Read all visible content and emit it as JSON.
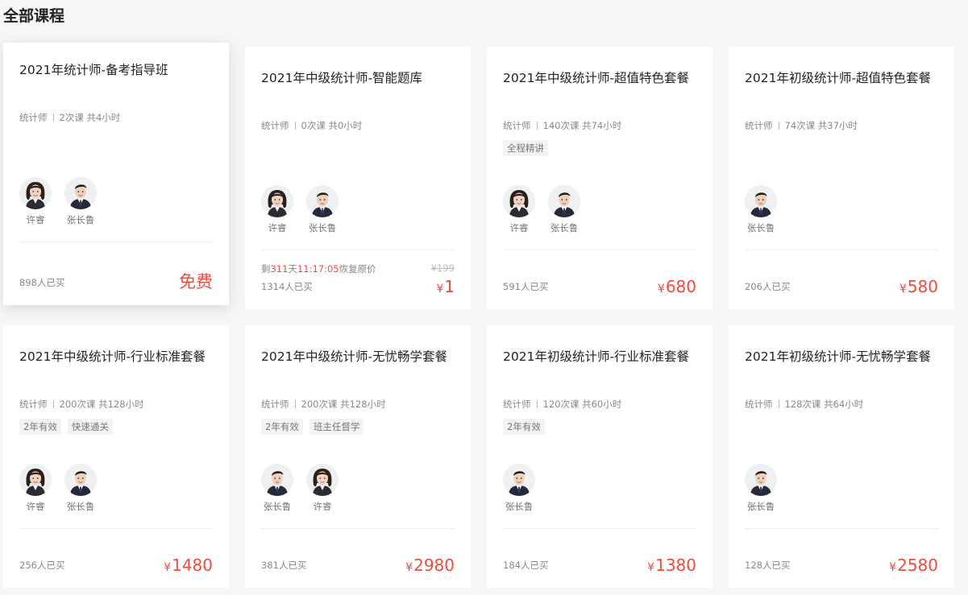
{
  "page": {
    "title": "全部课程"
  },
  "colors": {
    "accent": "#f24b3e",
    "background": "#f5f6f8"
  },
  "cards": [
    {
      "title": "2021年统计师-备考指导班",
      "category": "统计师",
      "lessons": "2次课 共4小时",
      "tags": [],
      "teachers": [
        {
          "name": "许睿",
          "icon": "female-teacher-avatar"
        },
        {
          "name": "张长鲁",
          "icon": "male-teacher-avatar"
        }
      ],
      "buyers": "898人已买",
      "price": "免费",
      "currency": ""
    },
    {
      "title": "2021年中级统计师-智能题库",
      "category": "统计师",
      "lessons": "0次课 共0小时",
      "tags": [],
      "teachers": [
        {
          "name": "许睿",
          "icon": "female-teacher-avatar"
        },
        {
          "name": "张长鲁",
          "icon": "male-teacher-avatar"
        }
      ],
      "buyers": "1314人已买",
      "price": "1",
      "currency": "¥",
      "countdown": {
        "prefix": "剩",
        "days": "311",
        "day_unit": "天",
        "time": "11:17:05",
        "suffix": "恢复原价"
      },
      "original_price": "¥199"
    },
    {
      "title": "2021年中级统计师-超值特色套餐",
      "category": "统计师",
      "lessons": "140次课 共74小时",
      "tags": [
        "全程精讲"
      ],
      "teachers": [
        {
          "name": "许睿",
          "icon": "female-teacher-avatar"
        },
        {
          "name": "张长鲁",
          "icon": "male-teacher-avatar"
        }
      ],
      "buyers": "591人已买",
      "price": "680",
      "currency": "¥"
    },
    {
      "title": "2021年初级统计师-超值特色套餐",
      "category": "统计师",
      "lessons": "74次课 共37小时",
      "tags": [],
      "teachers": [
        {
          "name": "张长鲁",
          "icon": "male-teacher-avatar"
        }
      ],
      "buyers": "206人已买",
      "price": "580",
      "currency": "¥"
    },
    {
      "title": "2021年中级统计师-行业标准套餐",
      "category": "统计师",
      "lessons": "200次课 共128小时",
      "tags": [
        "2年有效",
        "快速通关"
      ],
      "teachers": [
        {
          "name": "许睿",
          "icon": "female-teacher-avatar"
        },
        {
          "name": "张长鲁",
          "icon": "male-teacher-avatar"
        }
      ],
      "buyers": "256人已买",
      "price": "1480",
      "currency": "¥"
    },
    {
      "title": "2021年中级统计师-无忧畅学套餐",
      "category": "统计师",
      "lessons": "200次课 共128小时",
      "tags": [
        "2年有效",
        "班主任督学"
      ],
      "teachers": [
        {
          "name": "张长鲁",
          "icon": "male-teacher-avatar"
        },
        {
          "name": "许睿",
          "icon": "female-teacher-avatar"
        }
      ],
      "buyers": "381人已买",
      "price": "2980",
      "currency": "¥"
    },
    {
      "title": "2021年初级统计师-行业标准套餐",
      "category": "统计师",
      "lessons": "120次课 共60小时",
      "tags": [
        "2年有效"
      ],
      "teachers": [
        {
          "name": "张长鲁",
          "icon": "male-teacher-avatar"
        }
      ],
      "buyers": "184人已买",
      "price": "1380",
      "currency": "¥"
    },
    {
      "title": "2021年初级统计师-无忧畅学套餐",
      "category": "统计师",
      "lessons": "128次课 共64小时",
      "tags": [],
      "teachers": [
        {
          "name": "张长鲁",
          "icon": "male-teacher-avatar"
        }
      ],
      "buyers": "128人已买",
      "price": "2580",
      "currency": "¥"
    }
  ]
}
